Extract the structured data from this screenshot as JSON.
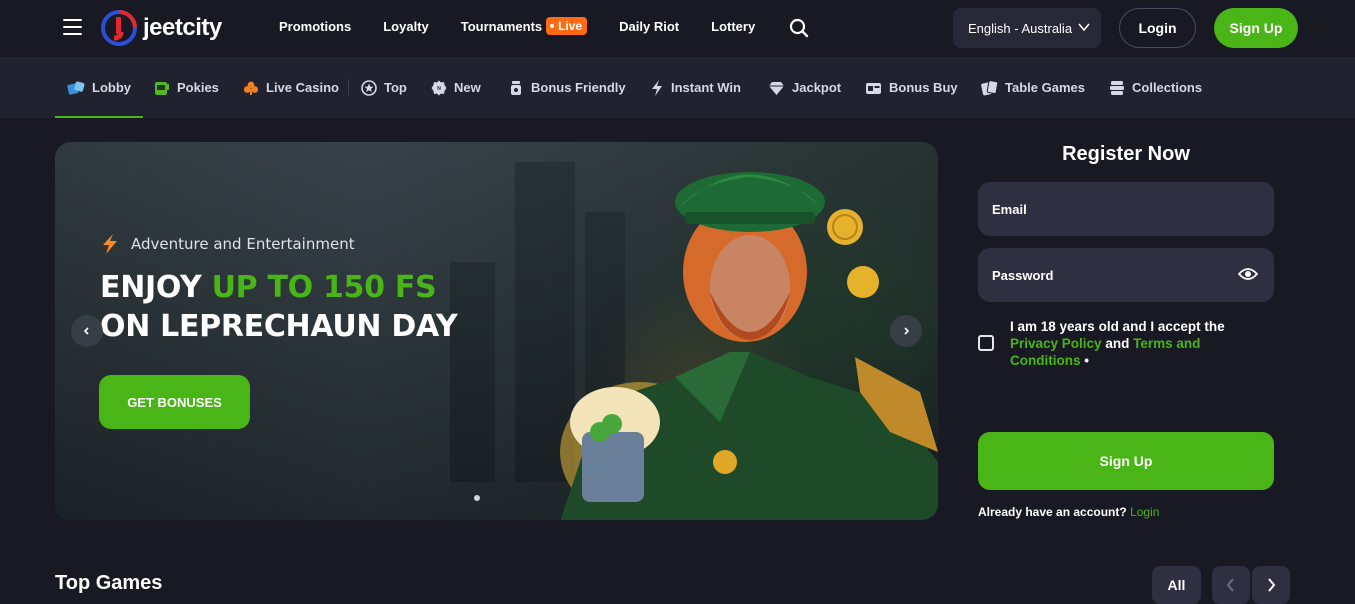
{
  "header": {
    "logo_text": "jeetcity",
    "nav": [
      {
        "label": "Promotions"
      },
      {
        "label": "Loyalty"
      },
      {
        "label": "Tournaments",
        "badge": "Live"
      },
      {
        "label": "Daily Riot"
      },
      {
        "label": "Lottery"
      }
    ],
    "language": "English - Australia",
    "login_label": "Login",
    "signup_label": "Sign Up"
  },
  "categories": [
    {
      "label": "Lobby",
      "icon": "dice-icon",
      "active": true
    },
    {
      "label": "Pokies",
      "icon": "slot-machine-icon"
    },
    {
      "label": "Live Casino",
      "icon": "club-icon"
    },
    {
      "label": "Top",
      "icon": "star-icon"
    },
    {
      "label": "New",
      "icon": "new-badge-icon"
    },
    {
      "label": "Bonus Friendly",
      "icon": "bonus-jar-icon"
    },
    {
      "label": "Instant Win",
      "icon": "lightning-icon"
    },
    {
      "label": "Jackpot",
      "icon": "diamond-icon"
    },
    {
      "label": "Bonus Buy",
      "icon": "ticket-icon"
    },
    {
      "label": "Table Games",
      "icon": "cards-icon"
    },
    {
      "label": "Collections",
      "icon": "stack-icon"
    }
  ],
  "banner": {
    "subtitle": "Adventure and Entertainment",
    "title_part1": "ENJOY ",
    "title_highlight": "UP TO 150 FS",
    "title_line2": "ON LEPRECHAUN DAY",
    "cta_label": "GET BONUSES"
  },
  "register": {
    "title": "Register Now",
    "email_placeholder": "Email",
    "password_placeholder": "Password",
    "consent_text": "I am 18 years old and I accept the",
    "privacy_label": "Privacy Policy",
    "and_label": "and",
    "terms_label": "Terms and Conditions",
    "required_mark": "•",
    "signup_label": "Sign Up",
    "have_account": "Already have an account?",
    "login_link": "Login"
  },
  "top_games": {
    "title": "Top Games",
    "all_label": "All"
  },
  "colors": {
    "accent": "#4ab516",
    "live_badge": "#ff6a13",
    "background": "#181922",
    "nav_background": "#202230",
    "field_background": "#2e3041"
  }
}
